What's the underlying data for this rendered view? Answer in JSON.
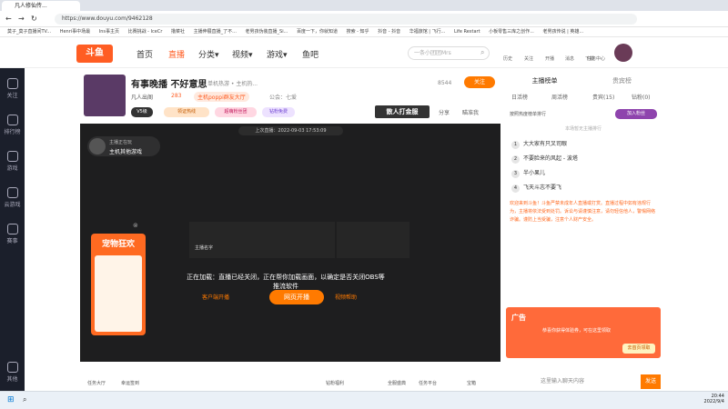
{
  "browser": {
    "tabs": [
      "凡人修仙传...",
      "",
      "",
      ""
    ],
    "url": "https://www.douyu.com/9462128",
    "bookmarks": [
      "莫子_莫子直播间TV...",
      "Henri事中场最",
      "Ins事主页",
      "比赛挑战 - IceCr",
      "撸菜社",
      "主播伸展直播_了不...",
      "老男孩伪装直播_Si...",
      "百度一下，你就知道",
      "搜索 - 知乎",
      "抖音 - 抖音",
      "华福旅馆 | 飞行...",
      "Life Restart",
      "小板零售三库之创作...",
      "老男孩传说 | 英雄..."
    ]
  },
  "header": {
    "logo": "斗鱼",
    "nav": [
      "首页",
      "直播",
      "分类▾",
      "视频▾",
      "游戏▾",
      "鱼吧"
    ],
    "search_placeholder": "一条小团团Mrs",
    "icons": [
      "历史",
      "关注",
      "开播",
      "消息",
      "下载",
      "任务中心"
    ]
  },
  "sidebar": [
    "关注",
    "排行榜",
    "游戏",
    "云游戏",
    "赛事",
    "其他"
  ],
  "room": {
    "title": "有事晚播 不好意思",
    "category": "单机热游 • 主机热...",
    "anchor": "凡人出阁",
    "heat": "283",
    "tag": "主机poppi群友大厅",
    "id_label": "公会：七爱",
    "room_num": "8544",
    "follow": "关注",
    "badges": [
      "V5级",
      "领证热线",
      "超萌粉丝团",
      "钻粉免费"
    ],
    "banner": "散人打金服",
    "share": "分享",
    "report": "瞄准我"
  },
  "player": {
    "info_bar": "上次直播：2022-09-03 17:53:09",
    "notice_label": "主播正在玩",
    "notice_sub": "主机其他游戏",
    "rec_name": "主播名字",
    "msg": "正在加载：直播已经关闭，正在帮你加载画面，以确定是否关闭OBS等推流软件",
    "client_btn": "客户端开播",
    "web_btn": "网页开播",
    "help": "视频帮助",
    "promo_title": "宠物狂欢",
    "bottom_labels": [
      "任务大厅",
      "幸运签到",
      "",
      "钻粉福利",
      "",
      "全服盛典",
      "任务平台",
      "宝箱"
    ]
  },
  "right": {
    "tabs_top": [
      "主播榜单",
      "贵宾榜"
    ],
    "tabs": [
      "日活榜",
      "周活榜",
      "贵宾(15)",
      "钻粉(0)"
    ],
    "rank_title": "按照热度榜单排行",
    "rank_btn": "加入粉丝",
    "rank_empty": "本场暂无主播排行",
    "ranks": [
      "大大家有只叉司眼",
      "不要脸来的风起 - 波塔",
      "半小果儿",
      "飞天斗志不要飞"
    ],
    "notice": "欢迎来到斗鱼！斗鱼严禁未成年人直播或打赏。直播过程中如有违规行为，主播将依法受到处罚。诉讼与请谨慎注意，请勿轻信他人，警惕网络诈骗。谨防上当受骗，注意个人财产安全。",
    "ad_title": "广告",
    "ad_text": "恭喜你获得体验券，可在这里领取",
    "ad_btn": "去首页领取",
    "chat_placeholder": "这里输入聊天内容",
    "send": "发送"
  },
  "taskbar": {
    "time": "20:44",
    "date": "2022/9/4"
  }
}
